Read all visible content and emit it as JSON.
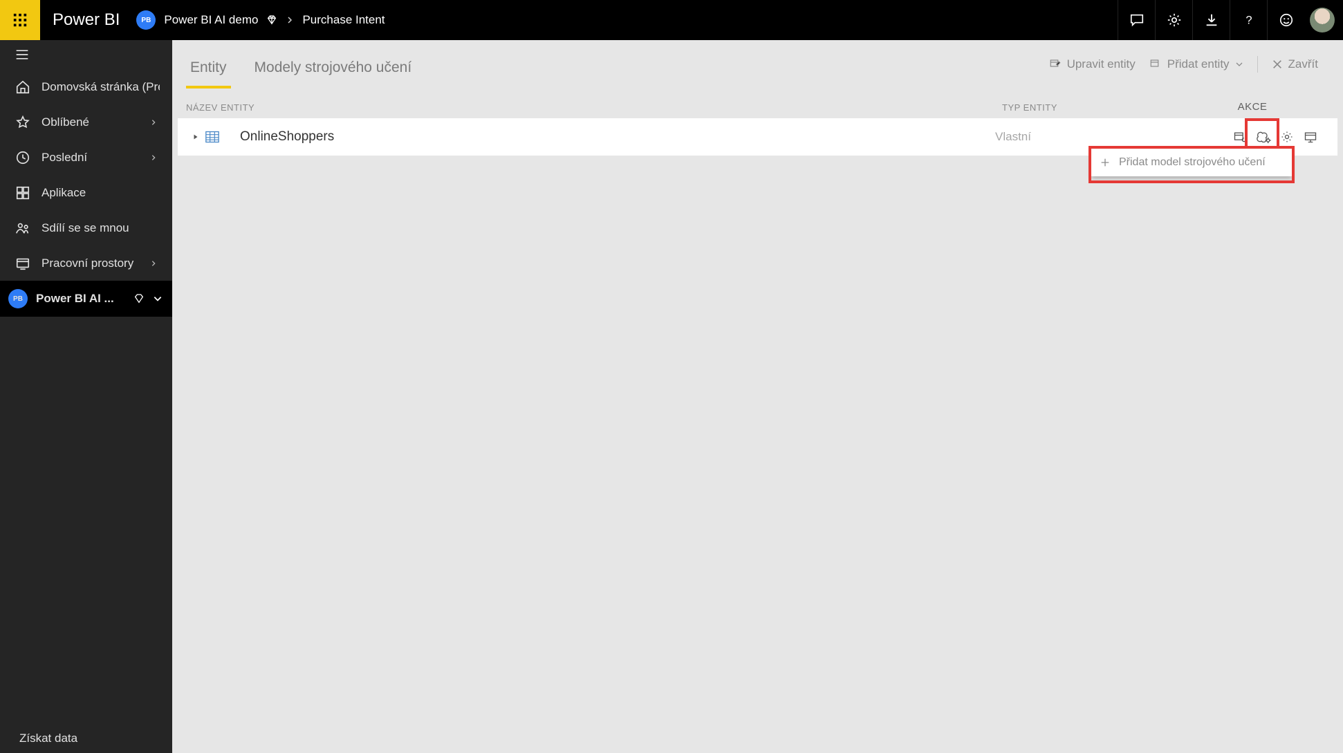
{
  "topbar": {
    "brand": "Power BI",
    "workspace_short": "PB",
    "workspace_name": "Power BI AI demo",
    "breadcrumb_current": "Purchase Intent"
  },
  "leftnav": {
    "items": [
      {
        "label": "Domovská stránka (Preview)",
        "expandable": false
      },
      {
        "label": "Oblíbené",
        "expandable": true
      },
      {
        "label": "Poslední",
        "expandable": true
      },
      {
        "label": "Aplikace",
        "expandable": false
      },
      {
        "label": "Sdílí se se mnou",
        "expandable": false
      },
      {
        "label": "Pracovní prostory",
        "expandable": true
      }
    ],
    "workspace_item": {
      "short": "PB",
      "label": "Power BI AI ..."
    },
    "footer": "Získat data"
  },
  "page": {
    "tab_active": "Entity",
    "tab_secondary": "Modely strojového učení",
    "actions": {
      "edit": "Upravit entity",
      "add": "Přidat entity",
      "close": "Zavřít"
    },
    "columns": {
      "name": "NÁZEV ENTITY",
      "type": "TYP ENTITY",
      "actions": "AKCE"
    },
    "entity": {
      "name": "OnlineShoppers",
      "type": "Vlastní"
    },
    "dropdown_item": "Přidat model strojového učení"
  }
}
